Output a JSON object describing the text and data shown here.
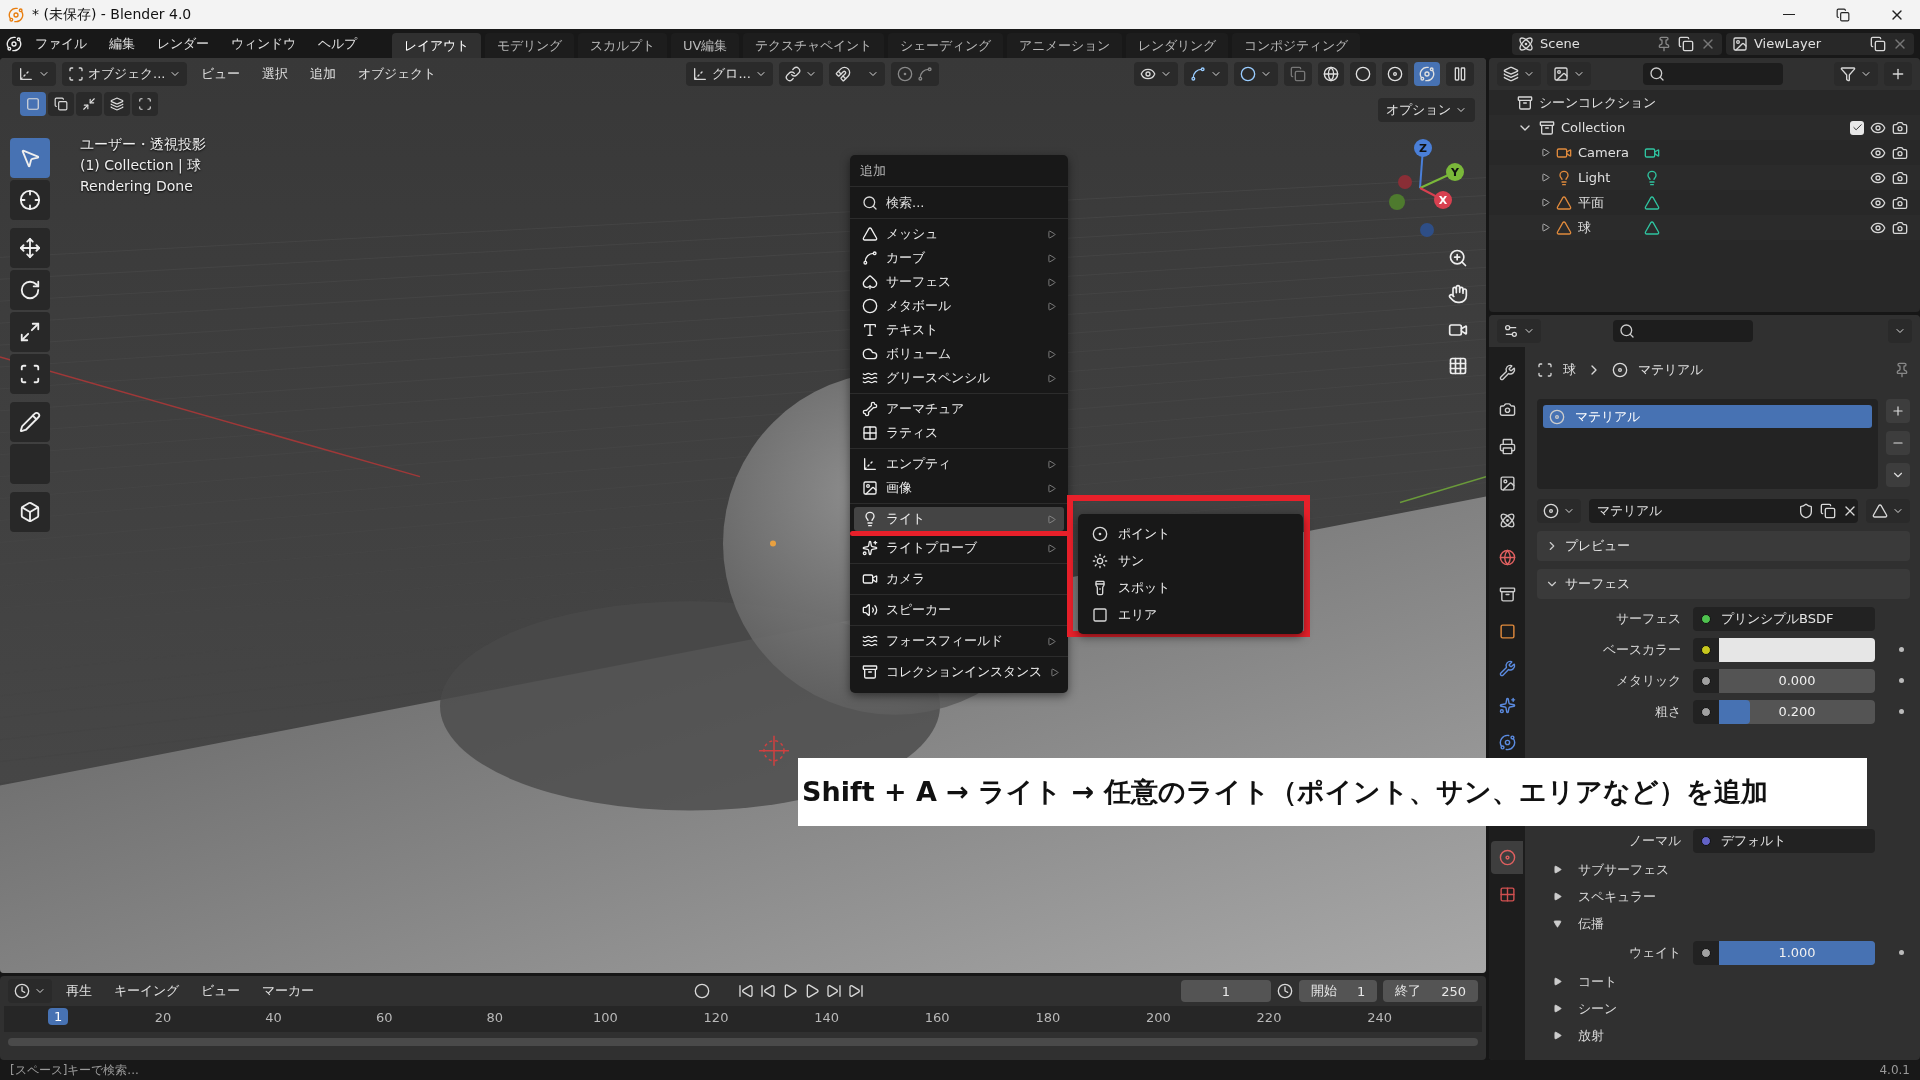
{
  "window": {
    "title": "* (未保存) - Blender 4.0"
  },
  "menu_bar": [
    "ファイル",
    "編集",
    "レンダー",
    "ウィンドウ",
    "ヘルプ"
  ],
  "workspace_tabs": [
    {
      "label": "レイアウト",
      "selected": true
    },
    {
      "label": "モデリング",
      "selected": false
    },
    {
      "label": "スカルプト",
      "selected": false
    },
    {
      "label": "UV編集",
      "selected": false
    },
    {
      "label": "テクスチャペイント",
      "selected": false
    },
    {
      "label": "シェーディング",
      "selected": false
    },
    {
      "label": "アニメーション",
      "selected": false
    },
    {
      "label": "レンダリング",
      "selected": false
    },
    {
      "label": "コンポジティング",
      "selected": false
    }
  ],
  "scene": {
    "name": "Scene"
  },
  "view_layer": {
    "name": "ViewLayer"
  },
  "viewport": {
    "mode": "オブジェク...",
    "menus": [
      "ビュー",
      "選択",
      "追加",
      "オブジェクト"
    ],
    "orientation": "グロ...",
    "options": "オプション",
    "select_modes": [
      {
        "selected": true
      },
      {
        "selected": false
      },
      {
        "selected": false
      },
      {
        "selected": false
      },
      {
        "selected": false
      }
    ],
    "shading_modes": [
      {
        "selected": false
      },
      {
        "selected": false
      },
      {
        "selected": false
      },
      {
        "selected": true
      }
    ],
    "tools": [
      {
        "selected": true
      },
      {
        "selected": false
      },
      {
        "selected": false
      },
      {
        "selected": false
      },
      {
        "selected": false
      },
      {
        "selected": false
      },
      {
        "selected": false
      },
      {
        "selected": false
      },
      {
        "selected": false
      }
    ],
    "info": [
      "ユーザー・透視投影",
      "(1) Collection | 球",
      "Rendering Done"
    ],
    "gizmo_axes": [
      "Z",
      "Y",
      "X"
    ]
  },
  "add_menu": {
    "title": "追加",
    "search": "検索...",
    "sections": [
      [
        {
          "label": "メッシュ",
          "submenu": true,
          "highlighted": false
        },
        {
          "label": "カーブ",
          "submenu": true,
          "highlighted": false
        },
        {
          "label": "サーフェス",
          "submenu": true,
          "highlighted": false
        },
        {
          "label": "メタボール",
          "submenu": true,
          "highlighted": false
        },
        {
          "label": "テキスト",
          "submenu": false,
          "highlighted": false
        },
        {
          "label": "ボリューム",
          "submenu": true,
          "highlighted": false
        },
        {
          "label": "グリースペンシル",
          "submenu": true,
          "highlighted": false
        }
      ],
      [
        {
          "label": "アーマチュア",
          "submenu": false,
          "highlighted": false
        },
        {
          "label": "ラティス",
          "submenu": false,
          "highlighted": false
        }
      ],
      [
        {
          "label": "エンプティ",
          "submenu": true,
          "highlighted": false
        },
        {
          "label": "画像",
          "submenu": true,
          "highlighted": false
        }
      ],
      [
        {
          "label": "ライト",
          "submenu": true,
          "highlighted": true
        },
        {
          "label": "ライトプローブ",
          "submenu": true,
          "highlighted": false
        }
      ],
      [
        {
          "label": "カメラ",
          "submenu": false,
          "highlighted": false
        }
      ],
      [
        {
          "label": "スピーカー",
          "submenu": false,
          "highlighted": false
        }
      ],
      [
        {
          "label": "フォースフィールド",
          "submenu": true,
          "highlighted": false
        }
      ],
      [
        {
          "label": "コレクションインスタンス",
          "submenu": true,
          "highlighted": false
        }
      ]
    ]
  },
  "light_submenu": [
    "ポイント",
    "サン",
    "スポット",
    "エリア"
  ],
  "caption": "Shift + A → ライト → 任意のライト（ポイント、サン、エリアなど）を追加",
  "outliner": {
    "root": "シーンコレクション",
    "collection": {
      "name": "Collection",
      "expanded": true,
      "checked": true,
      "children": [
        {
          "name": "Camera",
          "kind": "camera"
        },
        {
          "name": "Light",
          "kind": "light"
        },
        {
          "name": "平面",
          "kind": "mesh"
        },
        {
          "name": "球",
          "kind": "mesh"
        }
      ]
    }
  },
  "properties": {
    "tabs": [
      {
        "selected": false
      },
      {
        "selected": false
      },
      {
        "selected": false
      },
      {
        "selected": false
      },
      {
        "selected": false
      },
      {
        "selected": false
      },
      {
        "selected": false
      },
      {
        "selected": false
      },
      {
        "selected": false
      },
      {
        "selected": false
      },
      {
        "selected": false
      },
      {
        "selected": true
      },
      {
        "selected": false
      }
    ],
    "breadcrumb": [
      "球",
      "マテリアル"
    ],
    "slots": [
      {
        "name": "マテリアル",
        "selected": true
      }
    ],
    "material": "マテリアル",
    "panels": [
      {
        "title": "プレビュー",
        "expanded": false
      },
      {
        "title": "サーフェス",
        "expanded": true
      }
    ],
    "rows": [
      {
        "kind": "socket",
        "label": "サーフェス",
        "value": "プリンシプルBSDF",
        "color": "#4fc24f"
      },
      {
        "kind": "color",
        "label": "ベースカラー",
        "color": "#c8c81e"
      },
      {
        "kind": "slider",
        "label": "メタリック",
        "value": "0.000",
        "level": 0,
        "color": "#a1a1a1"
      },
      {
        "kind": "slider",
        "label": "粗さ",
        "value": "0.200",
        "level": 0.2,
        "color": "#a1a1a1"
      },
      {
        "kind": "hidden"
      },
      {
        "kind": "socket",
        "label": "ノーマル",
        "value": "デフォルト",
        "color": "#6363c7"
      },
      {
        "kind": "subpanel",
        "label": "サブサーフェス",
        "expanded": false
      },
      {
        "kind": "subpanel",
        "label": "スペキュラー",
        "expanded": false
      },
      {
        "kind": "subpanel",
        "label": "伝播",
        "expanded": true
      },
      {
        "kind": "slider",
        "label": "ウェイト",
        "value": "1.000",
        "level": 1,
        "color": "#a1a1a1"
      },
      {
        "kind": "subpanel",
        "label": "コート",
        "expanded": false
      },
      {
        "kind": "subpanel",
        "label": "シーン",
        "expanded": false
      },
      {
        "kind": "subpanel",
        "label": "放射",
        "expanded": false
      }
    ]
  },
  "timeline": {
    "menus": [
      "再生",
      "キーイング",
      "ビュー",
      "マーカー"
    ],
    "current_frame": "1",
    "start_label": "開始",
    "start": "1",
    "end_label": "終了",
    "end": "250",
    "playhead": "1",
    "ruler": [
      "20",
      "40",
      "60",
      "80",
      "100",
      "120",
      "140",
      "160",
      "180",
      "200",
      "220",
      "240"
    ]
  },
  "status_bar": {
    "hint": "[スペース]キーで検索...",
    "version": "4.0.1"
  }
}
